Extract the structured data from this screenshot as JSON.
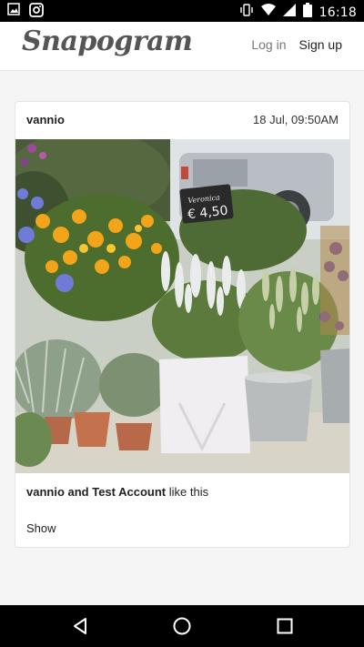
{
  "status_bar": {
    "time": "16:18",
    "icons": [
      "gallery-icon",
      "instagram-icon",
      "vibrate-icon",
      "wifi-icon",
      "signal-icon",
      "battery-icon"
    ]
  },
  "header": {
    "brand": "Snapogram",
    "login_label": "Log in",
    "signup_label": "Sign up"
  },
  "post": {
    "username": "vannio",
    "timestamp": "18 Jul, 09:50AM",
    "photo_sign_title": "Veronica",
    "photo_sign_price": "€ 4,50",
    "likes_names": "vannio and Test Account",
    "likes_suffix": " like this",
    "show_label": "Show"
  },
  "nav_bar": {
    "buttons": [
      "back-icon",
      "home-icon",
      "recents-icon"
    ]
  }
}
